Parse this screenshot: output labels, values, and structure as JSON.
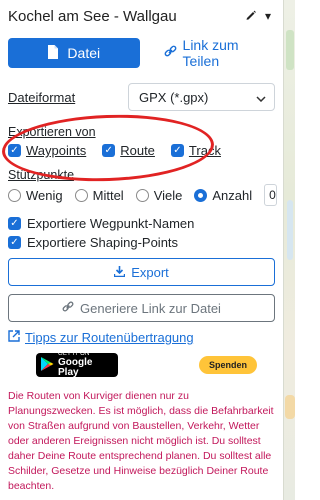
{
  "header": {
    "title": "Kochel am See - Wallgau"
  },
  "buttons": {
    "datei": "Datei",
    "share_link": "Link zum Teilen",
    "export": "Export",
    "generate_link": "Generiere Link zur Datei"
  },
  "format": {
    "label": "Dateiformat",
    "value": "GPX (*.gpx)"
  },
  "export_from": {
    "label": "Exportieren von",
    "items": [
      {
        "label": "Waypoints",
        "checked": true
      },
      {
        "label": "Route",
        "checked": true
      },
      {
        "label": "Track",
        "checked": true
      }
    ]
  },
  "stuetzpunkte": {
    "label": "Stützpunkte",
    "options": [
      {
        "label": "Wenig",
        "selected": false
      },
      {
        "label": "Mittel",
        "selected": false
      },
      {
        "label": "Viele",
        "selected": false
      },
      {
        "label": "Anzahl",
        "selected": true
      }
    ],
    "count": "0"
  },
  "options": [
    {
      "label": "Exportiere Wegpunkt-Namen",
      "checked": true
    },
    {
      "label": "Exportiere Shaping-Points",
      "checked": true
    }
  ],
  "tips_link": "Tipps zur Routenübertragung",
  "google_play": {
    "small": "GET IT ON",
    "big": "Google Play"
  },
  "donate": "Spenden",
  "disclaimer": "Die Routen von Kurviger dienen nur zu Planungszwecken. Es ist möglich, dass die Befahrbarkeit von Straßen aufgrund von Baustellen, Verkehr, Wetter oder anderen Ereignissen nicht möglich ist. Du solltest daher Deine Route entsprechend planen. Du solltest alle Schilder, Gesetze und Hinweise bezüglich Deiner Route beachten.",
  "colors": {
    "primary": "#1a6fd7",
    "annotation": "#e12323",
    "disclaimer": "#c2185b",
    "donate": "#ffc439"
  }
}
